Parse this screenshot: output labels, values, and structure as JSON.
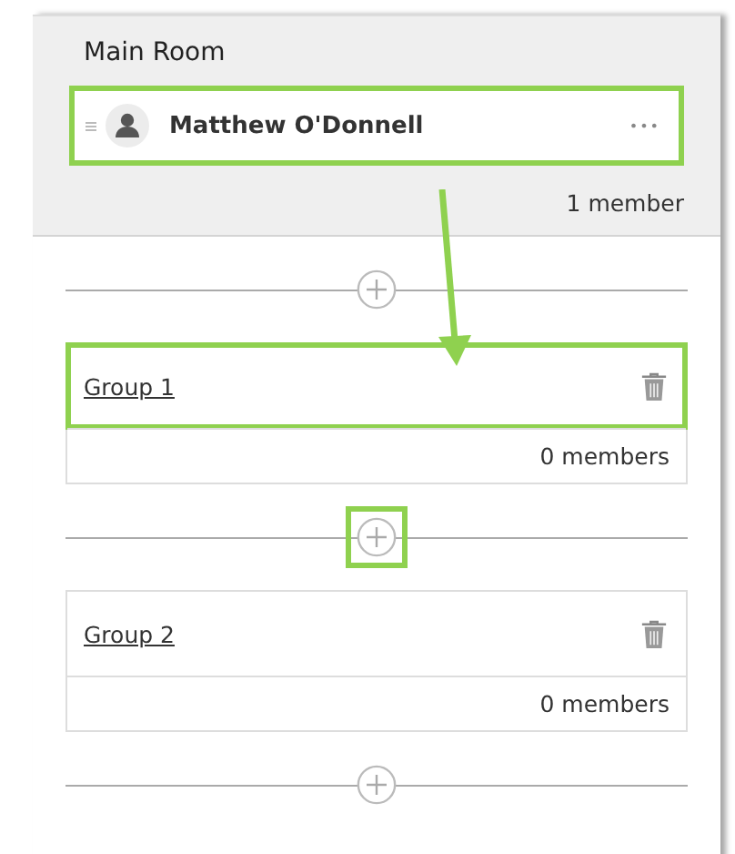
{
  "main_room": {
    "title": "Main Room",
    "members": [
      {
        "name": "Matthew O'Donnell",
        "menu": "•••",
        "highlighted": true
      }
    ],
    "count": "1 member"
  },
  "groups": [
    {
      "name": "Group 1",
      "count": "0 members",
      "highlighted": true
    },
    {
      "name": "Group 2",
      "count": "0 members",
      "highlighted": false
    }
  ],
  "add_buttons": [
    {
      "highlighted": false
    },
    {
      "highlighted": true
    },
    {
      "highlighted": false
    }
  ]
}
